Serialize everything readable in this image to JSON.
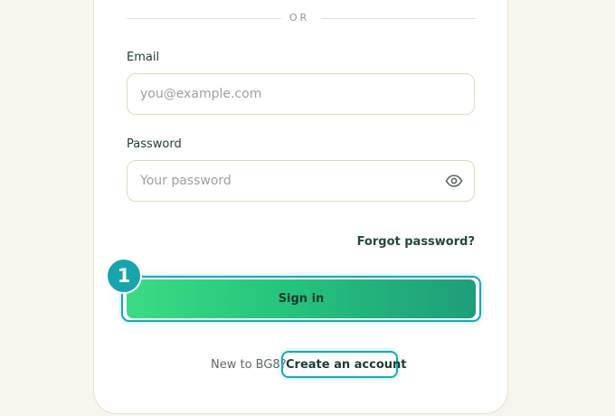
{
  "divider": {
    "text": "OR"
  },
  "email": {
    "label": "Email",
    "placeholder": "you@example.com"
  },
  "password": {
    "label": "Password",
    "placeholder": "Your password",
    "toggle_icon": "eye-icon"
  },
  "forgot_password": "Forgot password?",
  "sign_in_button": "Sign in",
  "step_badge": "1",
  "footer": {
    "prompt": "New to BG8?",
    "create_account": "Create an account"
  },
  "colors": {
    "accent_start": "#3bdb85",
    "accent_end": "#1f9d7a",
    "highlight": "#17a9b5",
    "text_dark": "#1f3b33"
  }
}
